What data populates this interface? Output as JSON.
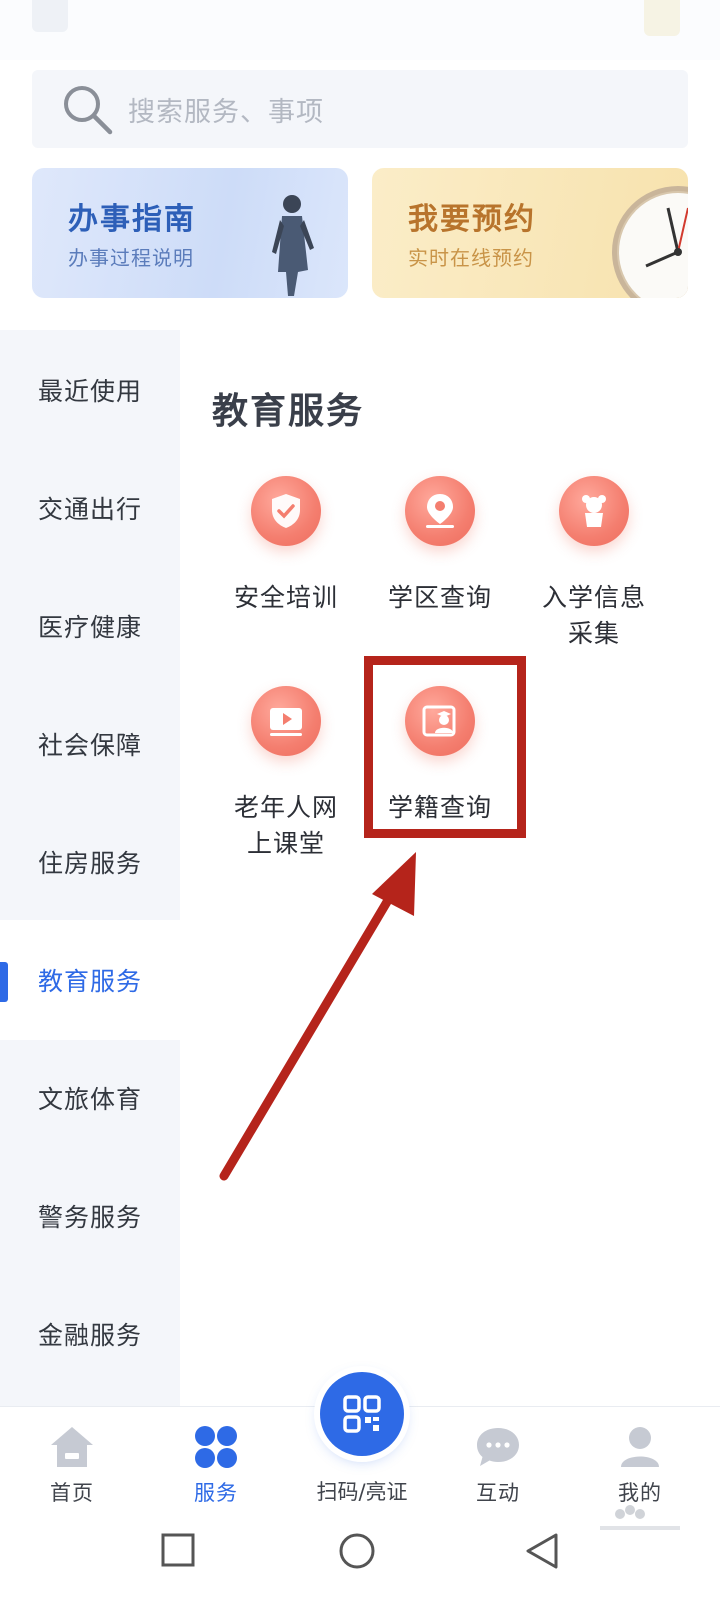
{
  "search": {
    "placeholder": "搜索服务、事项"
  },
  "banners": [
    {
      "title": "办事指南",
      "subtitle": "办事过程说明"
    },
    {
      "title": "我要预约",
      "subtitle": "实时在线预约"
    }
  ],
  "sidebar": {
    "items": [
      {
        "label": "最近使用"
      },
      {
        "label": "交通出行"
      },
      {
        "label": "医疗健康"
      },
      {
        "label": "社会保障"
      },
      {
        "label": "住房服务"
      },
      {
        "label": "教育服务",
        "active": true
      },
      {
        "label": "文旅体育"
      },
      {
        "label": "警务服务"
      },
      {
        "label": "金融服务"
      }
    ]
  },
  "content": {
    "section_title": "教育服务",
    "services": [
      {
        "label": "安全培训",
        "icon": "shield-check-icon"
      },
      {
        "label": "学区查询",
        "icon": "location-pin-icon"
      },
      {
        "label": "入学信息\n采集",
        "icon": "child-icon"
      },
      {
        "label": "老年人网\n上课堂",
        "icon": "video-play-icon"
      },
      {
        "label": "学籍查询",
        "icon": "student-card-icon"
      }
    ]
  },
  "bottom_nav": {
    "items": [
      {
        "label": "首页",
        "icon": "home-icon"
      },
      {
        "label": "服务",
        "icon": "apps-icon",
        "active": true
      },
      {
        "label": "扫码/亮证",
        "icon": "qr-code-icon"
      },
      {
        "label": "互动",
        "icon": "chat-bubble-icon"
      },
      {
        "label": "我的",
        "icon": "user-icon"
      }
    ]
  },
  "colors": {
    "accent": "#2e6ae6",
    "service_icon": "#f47e6f",
    "annotation": "#b5241b"
  }
}
